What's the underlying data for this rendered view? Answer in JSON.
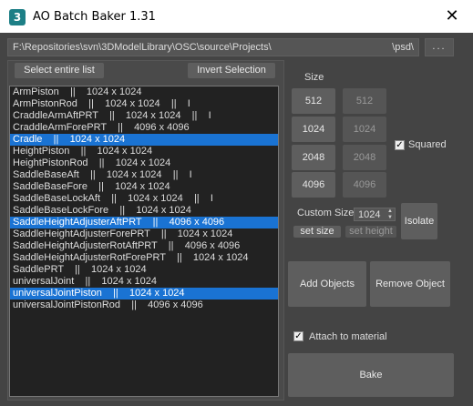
{
  "window": {
    "title": "AO Batch Baker 1.31",
    "icon_glyph": "3",
    "close_glyph": "✕"
  },
  "path": {
    "left": "F:\\Repositories\\svn\\3DModelLibrary\\OSC\\source\\Projects\\",
    "right": "\\psd\\",
    "browse_label": "..."
  },
  "buttons": {
    "select_all": "Select entire list",
    "invert": "Invert Selection",
    "add_objects": "Add Objects",
    "remove_object": "Remove Object",
    "isolate": "Isolate",
    "set_size": "set size",
    "set_height": "set height",
    "bake": "Bake"
  },
  "size": {
    "label": "Size",
    "width_options": [
      "512",
      "1024",
      "2048",
      "4096"
    ],
    "height_options": [
      "512",
      "1024",
      "2048",
      "4096"
    ],
    "squared_label": "Squared",
    "squared_checked": true,
    "custom_label": "Custom Size",
    "custom_value": "1024"
  },
  "attach_label": "Attach to material",
  "attach_checked": true,
  "list": [
    {
      "text": "ArmPiston    ||    1024 x 1024",
      "selected": false
    },
    {
      "text": "ArmPistonRod    ||    1024 x 1024    ||    I",
      "selected": false
    },
    {
      "text": "CraddleArmAftPRT    ||    1024 x 1024    ||    I",
      "selected": false
    },
    {
      "text": "CraddleArmForePRT    ||    4096 x 4096",
      "selected": false
    },
    {
      "text": "Cradle    ||    1024 x 1024",
      "selected": true
    },
    {
      "text": "HeightPiston    ||    1024 x 1024",
      "selected": false
    },
    {
      "text": "HeightPistonRod    ||    1024 x 1024",
      "selected": false
    },
    {
      "text": "SaddleBaseAft    ||    1024 x 1024    ||    I",
      "selected": false
    },
    {
      "text": "SaddleBaseFore    ||    1024 x 1024",
      "selected": false
    },
    {
      "text": "SaddleBaseLockAft    ||    1024 x 1024    ||    I",
      "selected": false
    },
    {
      "text": "SaddleBaseLockFore    ||    1024 x 1024",
      "selected": false
    },
    {
      "text": "SaddleHeightAdjusterAftPRT    ||    4096 x 4096",
      "selected": true
    },
    {
      "text": "SaddleHeightAdjusterForePRT    ||    1024 x 1024",
      "selected": false
    },
    {
      "text": "SaddleHeightAdjusterRotAftPRT    ||    4096 x 4096",
      "selected": false
    },
    {
      "text": "SaddleHeightAdjusterRotForePRT    ||    1024 x 1024",
      "selected": false
    },
    {
      "text": "SaddlePRT    ||    1024 x 1024",
      "selected": false
    },
    {
      "text": "universalJoint    ||    1024 x 1024",
      "selected": false
    },
    {
      "text": "universalJointPiston    ||    1024 x 1024",
      "selected": true
    },
    {
      "text": "universalJointPistonRod    ||    4096 x 4096",
      "selected": false
    }
  ]
}
